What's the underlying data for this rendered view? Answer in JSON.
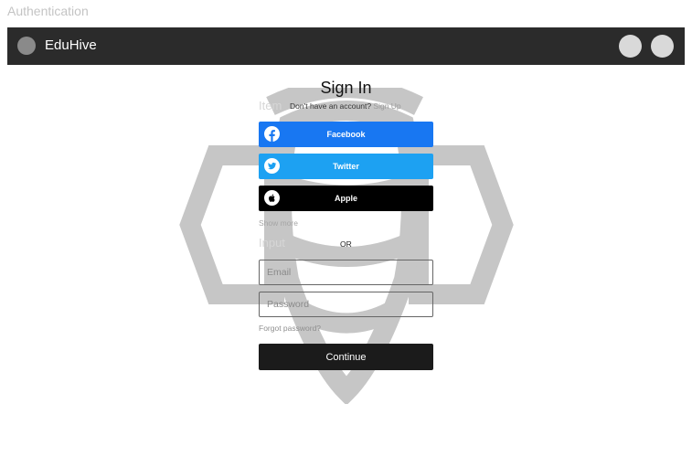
{
  "frame": {
    "title": "Authentication"
  },
  "header": {
    "brand": "EduHive",
    "actions": [
      "action-1",
      "action-2"
    ]
  },
  "auth": {
    "title": "Sign In",
    "signup_prompt": "Don't have an account?",
    "signup_link": "Sign Up",
    "providers": [
      {
        "label": "Facebook",
        "icon": "facebook-icon",
        "color": "#1877f2"
      },
      {
        "label": "Twitter",
        "icon": "twitter-icon",
        "color": "#1da1f2"
      },
      {
        "label": "Apple",
        "icon": "apple-icon",
        "color": "#000000"
      }
    ],
    "show_more": "Show more",
    "divider": "OR",
    "email_placeholder": "Email",
    "password_placeholder": "Password",
    "forgot": "Forgot password?",
    "continue": "Continue"
  },
  "ghost_labels": {
    "item": "Item",
    "input": "Input"
  },
  "colors": {
    "topbar": "#2b2b2b",
    "watermark": "#b3b3b3"
  }
}
